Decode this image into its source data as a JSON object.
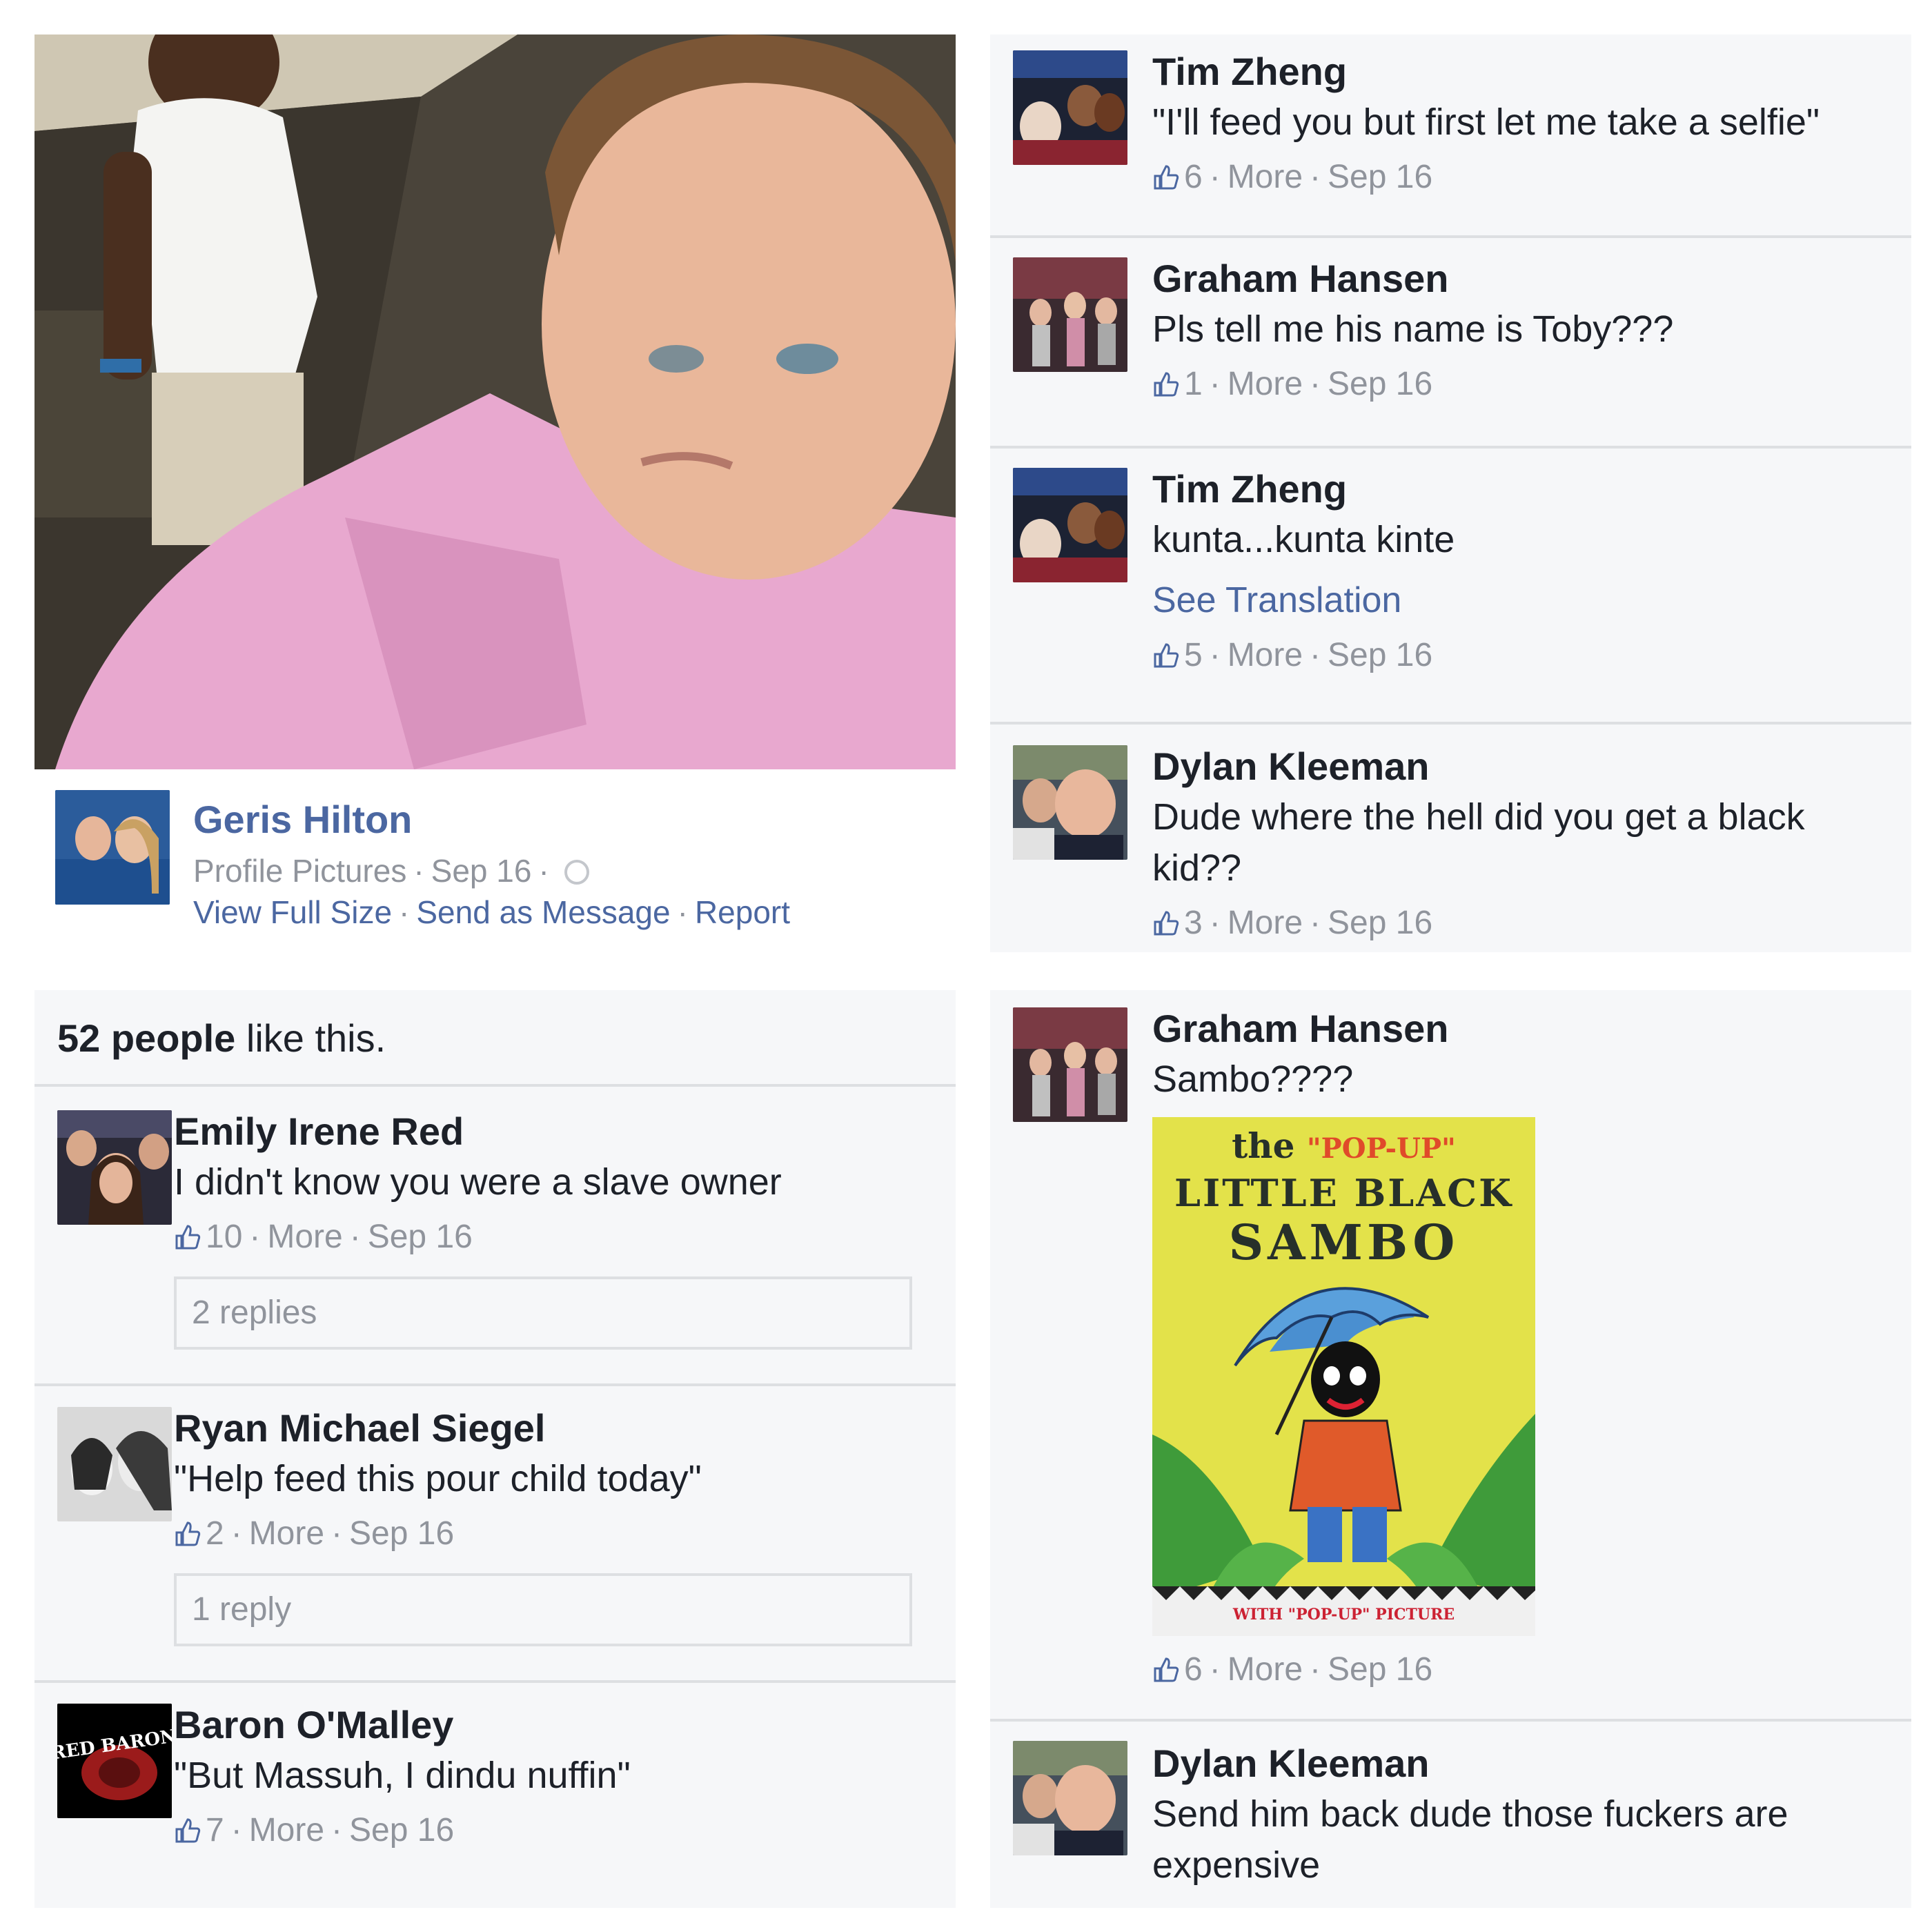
{
  "post": {
    "owner_name": "Geris Hilton",
    "album": "Profile Pictures",
    "date": "Sep 16",
    "actions": [
      "View Full Size",
      "Send as Message",
      "Report"
    ]
  },
  "likes_summary": {
    "count_text": "52 people",
    "suffix": " like this."
  },
  "comments_top_right": [
    {
      "name": "Tim Zheng",
      "text": "\"I'll feed you but first let me take a selfie\"",
      "likes": "6",
      "more": "More",
      "date": "Sep 16"
    },
    {
      "name": "Graham Hansen",
      "text": "Pls tell me his name is Toby???",
      "likes": "1",
      "more": "More",
      "date": "Sep 16"
    },
    {
      "name": "Tim Zheng",
      "text": "kunta...kunta kinte",
      "translate": "See Translation",
      "likes": "5",
      "more": "More",
      "date": "Sep 16"
    },
    {
      "name": "Dylan Kleeman",
      "text": "Dude where the hell did you get a black kid??",
      "likes": "3",
      "more": "More",
      "date": "Sep 16"
    }
  ],
  "comments_bottom_left": [
    {
      "name": "Emily Irene Red",
      "text": "I didn't know you were a slave owner",
      "likes": "10",
      "more": "More",
      "date": "Sep 16",
      "replies": "2 replies"
    },
    {
      "name": "Ryan Michael Siegel",
      "text": "\"Help feed this pour child today\"",
      "likes": "2",
      "more": "More",
      "date": "Sep 16",
      "replies": "1 reply"
    },
    {
      "name": "Baron O'Malley",
      "text": "\"But Massuh, I dindu nuffin\"",
      "likes": "7",
      "more": "More",
      "date": "Sep 16",
      "avatar_logo": "RED BARON"
    }
  ],
  "comments_bottom_right": [
    {
      "name": "Graham Hansen",
      "text": "Sambo????",
      "likes": "6",
      "more": "More",
      "date": "Sep 16",
      "attachment": {
        "line1_prefix": "the",
        "line1_highlight": "\"POP-UP\"",
        "line2": "LITTLE BLACK",
        "line3": "SAMBO",
        "footer": "WITH \"POP-UP\" PICTURE"
      }
    },
    {
      "name": "Dylan Kleeman",
      "text": "Send him back dude those fuckers are expensive"
    }
  ],
  "colors": {
    "link": "#4b67a1",
    "meta": "#90949c",
    "divider": "#dddfe2",
    "panel_bg": "#f6f7f9"
  }
}
